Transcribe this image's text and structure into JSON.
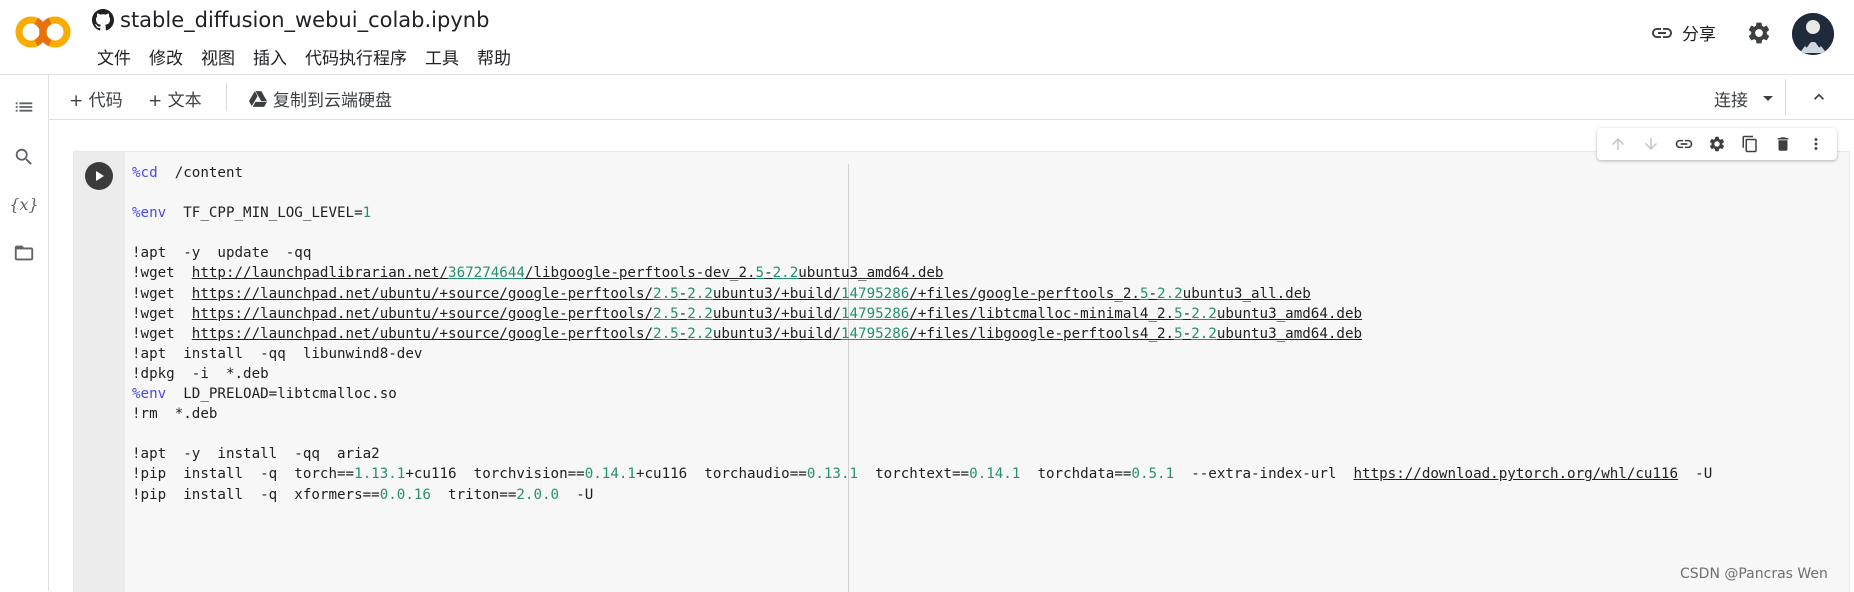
{
  "header": {
    "filename": "stable_diffusion_webui_colab.ipynb",
    "menu": [
      "文件",
      "修改",
      "视图",
      "插入",
      "代码执行程序",
      "工具",
      "帮助"
    ],
    "share_label": "分享",
    "logo_text": "CO"
  },
  "toolbar": {
    "add_code_label": "+ 代码",
    "add_text_label": "+ 文本",
    "copy_drive_label": "复制到云端硬盘",
    "connect_label": "连接"
  },
  "rail": {
    "items": [
      "toc-icon",
      "search-icon",
      "variables-icon",
      "files-icon"
    ]
  },
  "cell": {
    "lines": [
      [
        {
          "t": "%cd",
          "c": "magic"
        },
        {
          "t": "  /content"
        }
      ],
      [],
      [
        {
          "t": "%env",
          "c": "magic"
        },
        {
          "t": "  TF_CPP_MIN_LOG_LEVEL="
        },
        {
          "t": "1",
          "c": "num"
        }
      ],
      [],
      [
        {
          "t": "!apt  -y  update  -qq"
        }
      ],
      [
        {
          "t": "!wget  "
        },
        {
          "t": "http://launchpadlibrarian.net/",
          "c": "url"
        },
        {
          "t": "367274644",
          "c": "url num"
        },
        {
          "t": "/libgoogle-perftools-dev_2.",
          "c": "url"
        },
        {
          "t": "5",
          "c": "url num"
        },
        {
          "t": "-",
          "c": "url"
        },
        {
          "t": "2.2",
          "c": "url num"
        },
        {
          "t": "ubuntu3_amd64.deb",
          "c": "url"
        }
      ],
      [
        {
          "t": "!wget  "
        },
        {
          "t": "https://launchpad.net/ubuntu/+source/google-perftools/",
          "c": "url"
        },
        {
          "t": "2.5",
          "c": "url num"
        },
        {
          "t": "-",
          "c": "url"
        },
        {
          "t": "2.2",
          "c": "url num"
        },
        {
          "t": "ubuntu3/+build/",
          "c": "url"
        },
        {
          "t": "14795286",
          "c": "url num"
        },
        {
          "t": "/+files/google-perftools_2.",
          "c": "url"
        },
        {
          "t": "5",
          "c": "url num"
        },
        {
          "t": "-",
          "c": "url"
        },
        {
          "t": "2.2",
          "c": "url num"
        },
        {
          "t": "ubuntu3_all.deb",
          "c": "url"
        }
      ],
      [
        {
          "t": "!wget  "
        },
        {
          "t": "https://launchpad.net/ubuntu/+source/google-perftools/",
          "c": "url"
        },
        {
          "t": "2.5",
          "c": "url num"
        },
        {
          "t": "-",
          "c": "url"
        },
        {
          "t": "2.2",
          "c": "url num"
        },
        {
          "t": "ubuntu3/+build/",
          "c": "url"
        },
        {
          "t": "14795286",
          "c": "url num"
        },
        {
          "t": "/+files/libtcmalloc-minimal4_2.",
          "c": "url"
        },
        {
          "t": "5",
          "c": "url num"
        },
        {
          "t": "-",
          "c": "url"
        },
        {
          "t": "2.2",
          "c": "url num"
        },
        {
          "t": "ubuntu3_amd64.deb",
          "c": "url"
        }
      ],
      [
        {
          "t": "!wget  "
        },
        {
          "t": "https://launchpad.net/ubuntu/+source/google-perftools/",
          "c": "url"
        },
        {
          "t": "2.5",
          "c": "url num"
        },
        {
          "t": "-",
          "c": "url"
        },
        {
          "t": "2.2",
          "c": "url num"
        },
        {
          "t": "ubuntu3/+build/",
          "c": "url"
        },
        {
          "t": "14795286",
          "c": "url num"
        },
        {
          "t": "/+files/libgoogle-perftools4_2.",
          "c": "url"
        },
        {
          "t": "5",
          "c": "url num"
        },
        {
          "t": "-",
          "c": "url"
        },
        {
          "t": "2.2",
          "c": "url num"
        },
        {
          "t": "ubuntu3_amd64.deb",
          "c": "url"
        }
      ],
      [
        {
          "t": "!apt  install  -qq  libunwind8-dev"
        }
      ],
      [
        {
          "t": "!dpkg  -i  *.deb"
        }
      ],
      [
        {
          "t": "%env",
          "c": "magic"
        },
        {
          "t": "  LD_PRELOAD=libtcmalloc.so"
        }
      ],
      [
        {
          "t": "!rm  *.deb"
        }
      ],
      [],
      [
        {
          "t": "!apt  -y  install  -qq  aria2"
        }
      ],
      [
        {
          "t": "!pip  install  -q  torch=="
        },
        {
          "t": "1.13.1",
          "c": "num"
        },
        {
          "t": "+cu116  torchvision=="
        },
        {
          "t": "0.14.1",
          "c": "num"
        },
        {
          "t": "+cu116  torchaudio=="
        },
        {
          "t": "0.13.1",
          "c": "num"
        },
        {
          "t": "  torchtext=="
        },
        {
          "t": "0.14.1",
          "c": "num"
        },
        {
          "t": "  torchdata=="
        },
        {
          "t": "0.5.1",
          "c": "num"
        },
        {
          "t": "  --extra-index-url  "
        },
        {
          "t": "https://download.pytorch.org/whl/cu116",
          "c": "url"
        },
        {
          "t": "  -U"
        }
      ],
      [
        {
          "t": "!pip  install  -q  xformers=="
        },
        {
          "t": "0.0.16",
          "c": "num"
        },
        {
          "t": "  triton=="
        },
        {
          "t": "2.0.0",
          "c": "num"
        },
        {
          "t": "  -U"
        }
      ]
    ]
  },
  "watermark": "CSDN @Pancras Wen",
  "colors": {
    "magic": "#4a4ae0",
    "number": "#27906e",
    "logo_orange": "#f9ab00",
    "logo_dark": "#e8710a"
  }
}
